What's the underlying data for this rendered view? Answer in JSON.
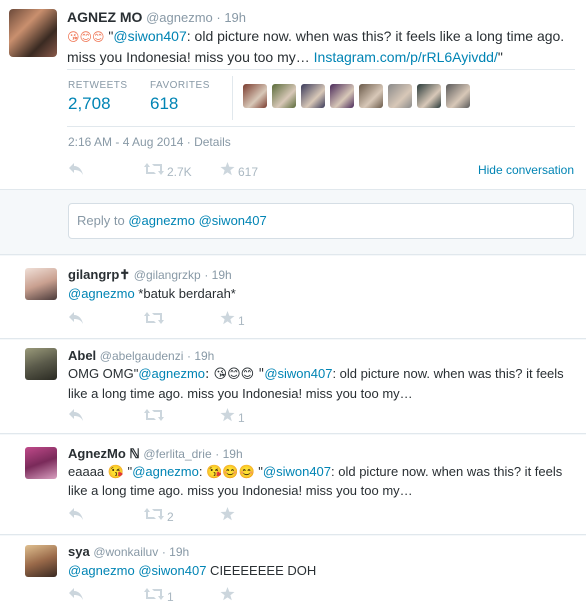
{
  "main_tweet": {
    "fullname": "AGNEZ MO",
    "screen_name": "@agnezmo",
    "time": "· 19h",
    "emoji_prefix": "😘😊😊",
    "text_part1": " \"",
    "mention": "@siwon407",
    "text_part2": ": old picture now. when was this? it feels like a long time ago. miss you Indonesia! miss you too my… ",
    "link": "Instagram.com/p/rRL6Ayivdd/",
    "text_part3": "\"",
    "retweets_label": "RETWEETS",
    "retweets_value": "2,708",
    "favorites_label": "FAVORITES",
    "favorites_value": "618",
    "datetime": "2:16 AM - 4 Aug 2014",
    "details": "Details",
    "retweet_count": "2.7K",
    "favorite_count": "617",
    "hide_conversation": "Hide conversation",
    "favoriter_colors": [
      "#7a3b2e",
      "#5a6b3a",
      "#3a3a5a",
      "#4a2a5a",
      "#6a5a4a",
      "#8a8a8a",
      "#2a3a3a",
      "#5a5a5a"
    ]
  },
  "reply_box": {
    "prefix": "Reply to ",
    "mentions": "@agnezmo @siwon407"
  },
  "icons": {
    "reply": "reply-icon",
    "retweet": "retweet-icon",
    "favorite": "star-icon",
    "verified": "verified-icon"
  },
  "replies": [
    {
      "fullname": "gilangrp✝",
      "screen_name": "@gilangrzkp",
      "time": "· 19h",
      "mention1": "@agnezmo",
      "text": " *batuk berdarah*",
      "retweet_count": "",
      "favorite_count": "1",
      "avatar_color": "#d9b8a8"
    },
    {
      "fullname": "Abel",
      "screen_name": "@abelgaudenzi",
      "time": "· 19h",
      "text_a": "OMG OMG\"",
      "mention1": "@agnezmo",
      "text_b": ": 😘😊😊 \"",
      "mention2": "@siwon407",
      "text_c": ": old picture now. when was this? it feels like a long time ago. miss you Indonesia! miss you too my…",
      "retweet_count": "",
      "favorite_count": "1",
      "avatar_color": "#6b6b5a"
    },
    {
      "fullname": "AgnezMo ℕ",
      "screen_name": "@ferlita_drie",
      "time": "· 19h",
      "text_a": "eaaaa 😘 \"",
      "mention1": "@agnezmo",
      "text_b": ": 😘😊😊 \"",
      "mention2": "@siwon407",
      "text_c": ": old picture now. when was this? it feels like a long time ago. miss you Indonesia! miss you too my…",
      "retweet_count": "2",
      "favorite_count": "",
      "avatar_color": "#8a3a6a"
    },
    {
      "fullname": "sya",
      "screen_name": "@wonkailuv",
      "time": "· 19h",
      "mention1": "@agnezmo",
      "mention2": "@siwon407",
      "text": " CIEEEEEEE DOH",
      "retweet_count": "1",
      "favorite_count": "",
      "avatar_color": "#b08a6a"
    }
  ]
}
